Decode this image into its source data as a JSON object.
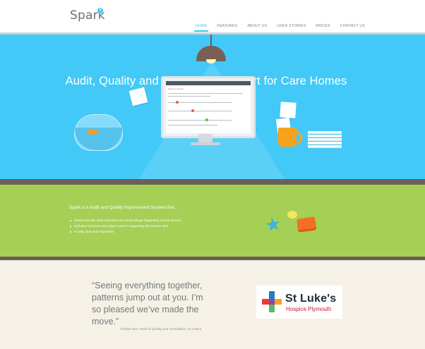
{
  "header": {
    "logo_text": "Spark",
    "logo_badge": "8",
    "nav": [
      {
        "label": "HOME",
        "active": true
      },
      {
        "label": "FEATURES",
        "active": false
      },
      {
        "label": "ABOUT US",
        "active": false
      },
      {
        "label": "USER STORIES",
        "active": false
      },
      {
        "label": "PRICES",
        "active": false
      },
      {
        "label": "CONTACT US",
        "active": false
      }
    ]
  },
  "hero": {
    "title": "Audit, Quality and Inspection Support for Care Homes",
    "screen_title": "Sensory Checks"
  },
  "features": {
    "heading": "Spark is a Audit and Quality Improvement System that...",
    "items": [
      "Shows you the most important and useful things happening in your service",
      "Includes everyone who plays a part in supporting the service user",
      "Is easy, fast and responsive"
    ]
  },
  "testimonial": {
    "quote": "“Seeing everything together, patterns jump out at you. I’m so pleased we’ve made the move.”",
    "author": "Frankie Dee, Head of Quality and Compliance, St Luke's",
    "partner_name": "St Luke's",
    "partner_sub": "Hospice Plymouth"
  },
  "colors": {
    "accent": "#3fc3ee",
    "hero_bg": "#42c9f7",
    "green_bg": "#a6cf56",
    "desk": "#6a6058",
    "cream": "#f5f1e6",
    "partner_red": "#c4162a"
  }
}
